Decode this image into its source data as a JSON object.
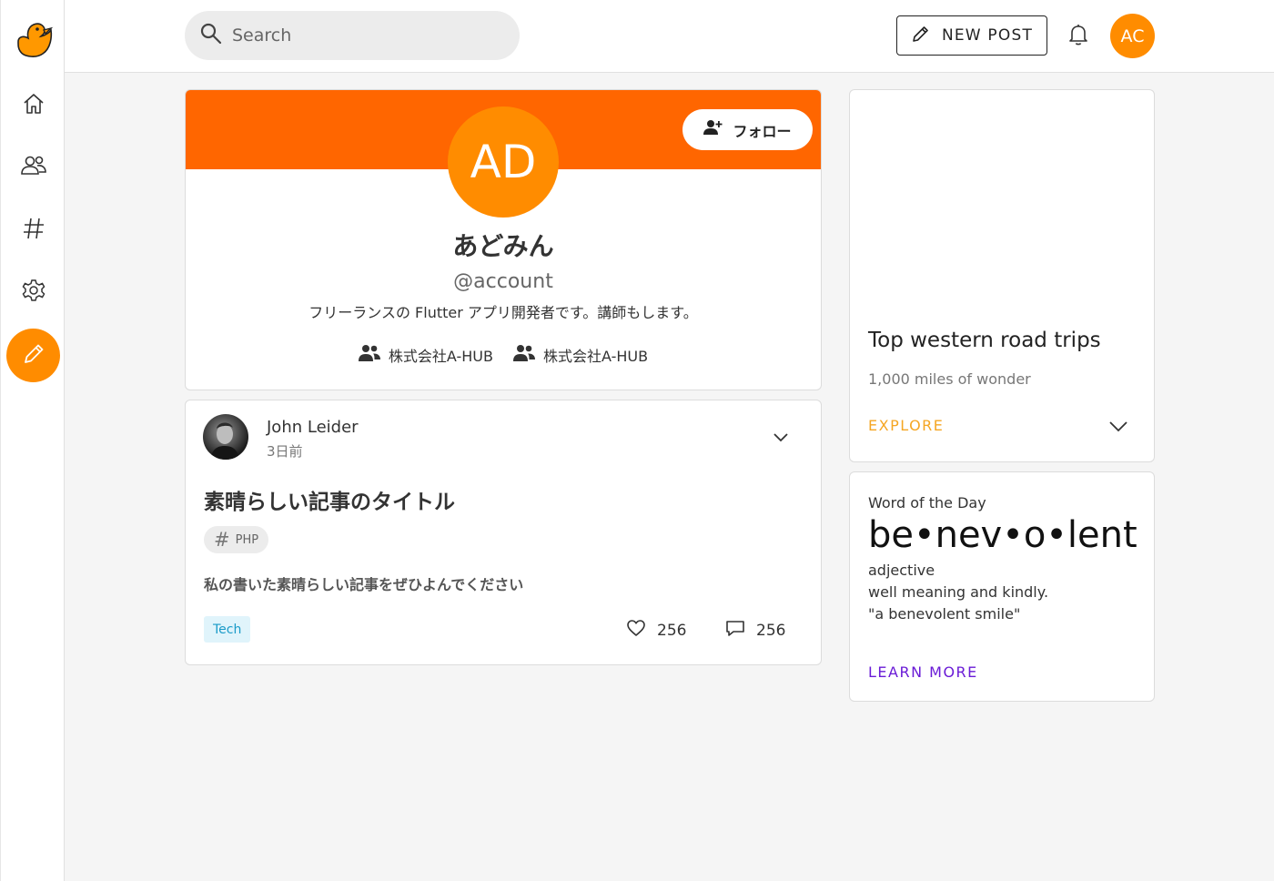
{
  "theme": {
    "accent": "#ff8c00",
    "banner": "#ff6600",
    "explore_color": "#f5a623",
    "learn_color": "#6a1bd6"
  },
  "rail": {
    "items": [
      {
        "icon": "home-icon"
      },
      {
        "icon": "people-icon"
      },
      {
        "icon": "hashtag-icon"
      },
      {
        "icon": "gear-icon"
      }
    ],
    "fab_icon": "pencil-icon"
  },
  "topbar": {
    "search_placeholder": "Search",
    "new_post_label": "NEW POST",
    "user_initials": "AC"
  },
  "profile": {
    "initials": "AD",
    "follow_label": "フォロー",
    "name": "あどみん",
    "handle": "@account",
    "bio": "フリーランスの Flutter アプリ開発者です。講師もします。",
    "orgs": [
      "株式会社A-HUB",
      "株式会社A-HUB"
    ]
  },
  "post": {
    "author": "John Leider",
    "time": "3日前",
    "title": "素晴らしい記事のタイトル",
    "tag": "PHP",
    "excerpt": "私の書いた素晴らしい記事をぜひよんでください",
    "category": "Tech",
    "likes": "256",
    "comments": "256"
  },
  "trip_card": {
    "title": "Top western road trips",
    "subtitle": "1,000 miles of wonder",
    "action": "EXPLORE"
  },
  "word_card": {
    "label": "Word of the Day",
    "term": "be•nev•o•lent",
    "part_of_speech": "adjective",
    "definition": "well meaning and kindly.",
    "example": "\"a benevolent smile\"",
    "action": "LEARN MORE"
  }
}
